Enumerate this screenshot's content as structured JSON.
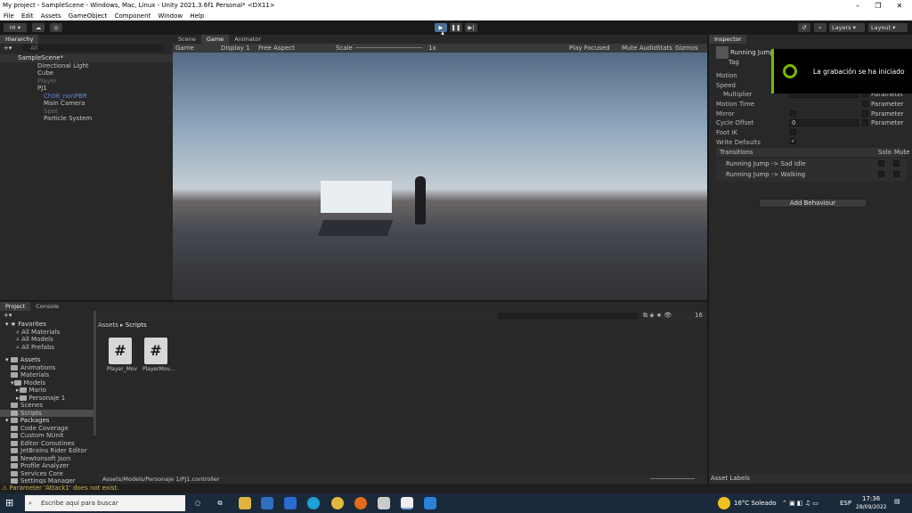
{
  "title_bar": {
    "title": "My project - SampleScene - Windows, Mac, Linux - Unity 2021.3.6f1 Personal* <DX11>",
    "min": "–",
    "max": "❐",
    "close": "✕"
  },
  "menu": [
    "File",
    "Edit",
    "Assets",
    "GameObject",
    "Component",
    "Window",
    "Help"
  ],
  "toolbar": {
    "account": "HI ▾",
    "layers": "Layers",
    "layout": "Layout"
  },
  "hierarchy": {
    "tab": "Hierarchy",
    "search": "All",
    "items": [
      "SampleScene*",
      "Directional Light",
      "Cube",
      "Player",
      "PJ1",
      "Ch06_nonPBR",
      "Main Camera",
      "Spot",
      "Particle System"
    ]
  },
  "gameview": {
    "tabs": [
      "Scene",
      "Game",
      "Animator"
    ],
    "game_label": "Game",
    "display": "Display 1",
    "aspect": "Free Aspect",
    "scale_label": "Scale",
    "scale_value": "1x",
    "play_focused": "Play Focused",
    "mute": "Mute Audio",
    "stats": "Stats",
    "gizmos": "Gizmos"
  },
  "inspector": {
    "tab": "Inspector",
    "name": "Running Jump",
    "tag": "Tag",
    "rows": [
      "Motion",
      "Speed",
      "Multiplier",
      "Motion Time",
      "Mirror",
      "Cycle Offset",
      "Foot IK",
      "Write Defaults"
    ],
    "param": "Parameter",
    "cycle_value": "0",
    "transitions_label": "Transitions",
    "solo": "Solo",
    "mute": "Mute",
    "transitions": [
      "Running Jump -> Sad Idle",
      "Running Jump -> Walking"
    ],
    "add_behaviour": "Add Behaviour",
    "asset_labels": "Asset Labels"
  },
  "notification": {
    "text": "La grabación se ha iniciado"
  },
  "project": {
    "tabs": [
      "Project",
      "Console"
    ],
    "favorites": "Favorites",
    "fav_items": [
      "All Materials",
      "All Models",
      "All Prefabs"
    ],
    "assets": "Assets",
    "asset_items": [
      "Animations",
      "Materials",
      "Models",
      "Mario",
      "Personaje 1",
      "Scenes",
      "Scripts"
    ],
    "packages": "Packages",
    "package_items": [
      "Code Coverage",
      "Custom NUnit",
      "Editor Coroutines",
      "JetBrains Rider Editor",
      "Newtonsoft Json",
      "Profile Analyzer",
      "Services Core",
      "Settings Manager"
    ],
    "breadcrumb": [
      "Assets",
      "Scripts"
    ],
    "files": [
      "Player_Mov",
      "PlayerMov..."
    ],
    "count": "16",
    "path": "Assets/Models/Personaje 1/PJ1.controller"
  },
  "status": {
    "message": "Parameter 'Attack1' does not exist."
  },
  "taskbar": {
    "search": "Escribe aquí para buscar",
    "weather": "16°C  Soleado",
    "lang": "ESP",
    "time": "17:36",
    "date": "28/09/2022"
  }
}
